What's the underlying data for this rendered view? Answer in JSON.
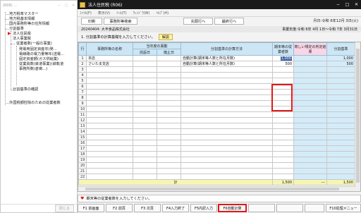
{
  "left_window": {
    "title": "(R06) ...",
    "tree": [
      "地方税率マスター",
      "地方税基本情報",
      "国内事務所等の住所情報",
      "分割基準",
      "法人住民税",
      "法人事業税",
      "従業者数(一般の事業)",
      "発電用固定資産年(発...",
      "電線路の電力量等年(送電...",
      "固定資産額(ガス供給業)",
      "従業員数(鉄道事業)(鉄軌道",
      "事務所数(倉庫...)",
      "分割基準の確認",
      "外国税額控除のための従業者数"
    ],
    "footer_button": "閉じる"
  },
  "window": {
    "title": "法人住民税 (R06)"
  },
  "menu": [
    "ﾌｧｲﾙ(F)",
    "表示(V)",
    "ﾂｰﾙ(T)",
    "ｳｨﾝﾄﾞｳ(W)",
    "ﾍﾙﾌﾟ(H)"
  ],
  "toolbar": {
    "print": "印刷",
    "office_search": "事務所等検索",
    "first_row": "先頭行へ",
    "last_row": "最終行へ",
    "date": "月日:令和 6年12月 3日(火)"
  },
  "info": {
    "company": "20240404: 大丰食品株式会社",
    "fiscal_year": "事業年度:令和 6年 4月 1日〜令和 7年 3月31日"
  },
  "instruction": {
    "text": "1. 分割基準の計算基礎を入力してください。",
    "explain_button": "解説"
  },
  "grid": {
    "headers": {
      "row": "行",
      "office_name": "事務所等の名称",
      "period_group": "当年度の異動",
      "before": "前設日",
      "after": "廃止日",
      "calc_method": "分割基準の計算方法",
      "employees_end": "期末等の従業者数",
      "judgment": "寄しい規定の判定結果",
      "basis": "分割基準"
    },
    "rows": [
      {
        "n": "1",
        "name": "本店",
        "method": "自動計算(期末等人数と所在月数)",
        "emp": "1,000",
        "basis": "1,000"
      },
      {
        "n": "2",
        "name": "さいたま支店",
        "method": "自動計算(期末等人数と所在月数)",
        "emp": "500",
        "basis": "500"
      },
      {
        "n": "3"
      },
      {
        "n": "4"
      },
      {
        "n": "5"
      },
      {
        "n": "6"
      },
      {
        "n": "7"
      },
      {
        "n": "8"
      },
      {
        "n": "9"
      },
      {
        "n": "10"
      },
      {
        "n": "11"
      },
      {
        "n": "12"
      },
      {
        "n": "13"
      },
      {
        "n": "14"
      },
      {
        "n": "15"
      },
      {
        "n": "16"
      },
      {
        "n": "17"
      },
      {
        "n": "18"
      },
      {
        "n": "19"
      },
      {
        "n": "20"
      },
      {
        "n": "21"
      },
      {
        "n": "22"
      }
    ],
    "total": {
      "label": "計",
      "emp": "1,500",
      "judgment": "---",
      "basis": "1,500"
    }
  },
  "status": "期末等の従業者数を入力してください。",
  "fkeys": {
    "f1": "F1 前画面",
    "f2": "F2 前頁",
    "f3": "F3 次頁",
    "f4": "F4入力終了",
    "f5": "F5内訳入力",
    "f6": "F6自動計算",
    "f10": "F10処理メニュー"
  },
  "colors": {
    "header_blue": "#cde6f5",
    "highlight_red": "#e01818",
    "total_yellow": "#f6f6b4"
  }
}
